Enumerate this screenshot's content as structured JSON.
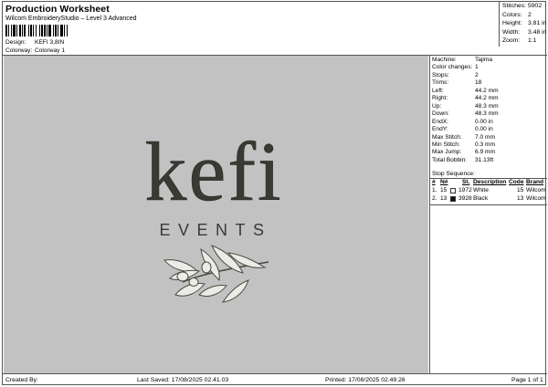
{
  "header": {
    "title": "Production Worksheet",
    "subtitle": "Wilcom EmbroideryStudio – Level 3 Advanced",
    "design_label": "Design:",
    "design_value": "KEFI 3,8IN",
    "colorway_label": "Colorway:",
    "colorway_value": "Colorway 1"
  },
  "summary": [
    {
      "label": "Stitches:",
      "value": "5902"
    },
    {
      "label": "Colors:",
      "value": "2"
    },
    {
      "label": "Height:",
      "value": "3.81 in"
    },
    {
      "label": "Width:",
      "value": "3.48 in"
    },
    {
      "label": "Zoom:",
      "value": "1:1"
    }
  ],
  "design": {
    "logo_word": "kefi",
    "logo_sub": "EVENTS",
    "background_color": "#c2c2c2",
    "thread_color": "#3a3a34",
    "leaf_color": "#ecece6"
  },
  "machine_info": [
    {
      "label": "Machine:",
      "value": "Tajima"
    },
    {
      "label": "Color changes:",
      "value": "1"
    },
    {
      "label": "Stops:",
      "value": "2"
    },
    {
      "label": "Trims:",
      "value": "18"
    },
    {
      "label": "Left:",
      "value": "44.2 mm"
    },
    {
      "label": "Right:",
      "value": "44.2 mm"
    },
    {
      "label": "Up:",
      "value": "48.3 mm"
    },
    {
      "label": "Down:",
      "value": "48.3 mm"
    },
    {
      "label": "EndX:",
      "value": "0.00 in"
    },
    {
      "label": "EndY:",
      "value": "0.00 in"
    },
    {
      "label": "Max Stitch:",
      "value": "7.0 mm"
    },
    {
      "label": "Min Stitch:",
      "value": "0.3 mm"
    },
    {
      "label": "Max Jump:",
      "value": "6.9 mm"
    },
    {
      "label": "Total Bobbin:",
      "value": "31.13ft"
    }
  ],
  "stop_sequence": {
    "title": "Stop Sequence:",
    "columns": [
      "#",
      "N#",
      "St.",
      "Description",
      "Code",
      "Brand"
    ],
    "rows": [
      {
        "num": "1.",
        "needle": "15",
        "color": "#ffffff",
        "stitches": "1972",
        "description": "White",
        "code": "15",
        "brand": "Wilcom"
      },
      {
        "num": "2.",
        "needle": "13",
        "color": "#111111",
        "stitches": "3928",
        "description": "Black",
        "code": "13",
        "brand": "Wilcom"
      }
    ]
  },
  "footer": {
    "created": "Created By:",
    "saved": "Last Saved: 17/08/2025 02.41.03",
    "printed": "Printed: 17/08/2025 02.49.26",
    "page": "Page 1 of 1"
  }
}
